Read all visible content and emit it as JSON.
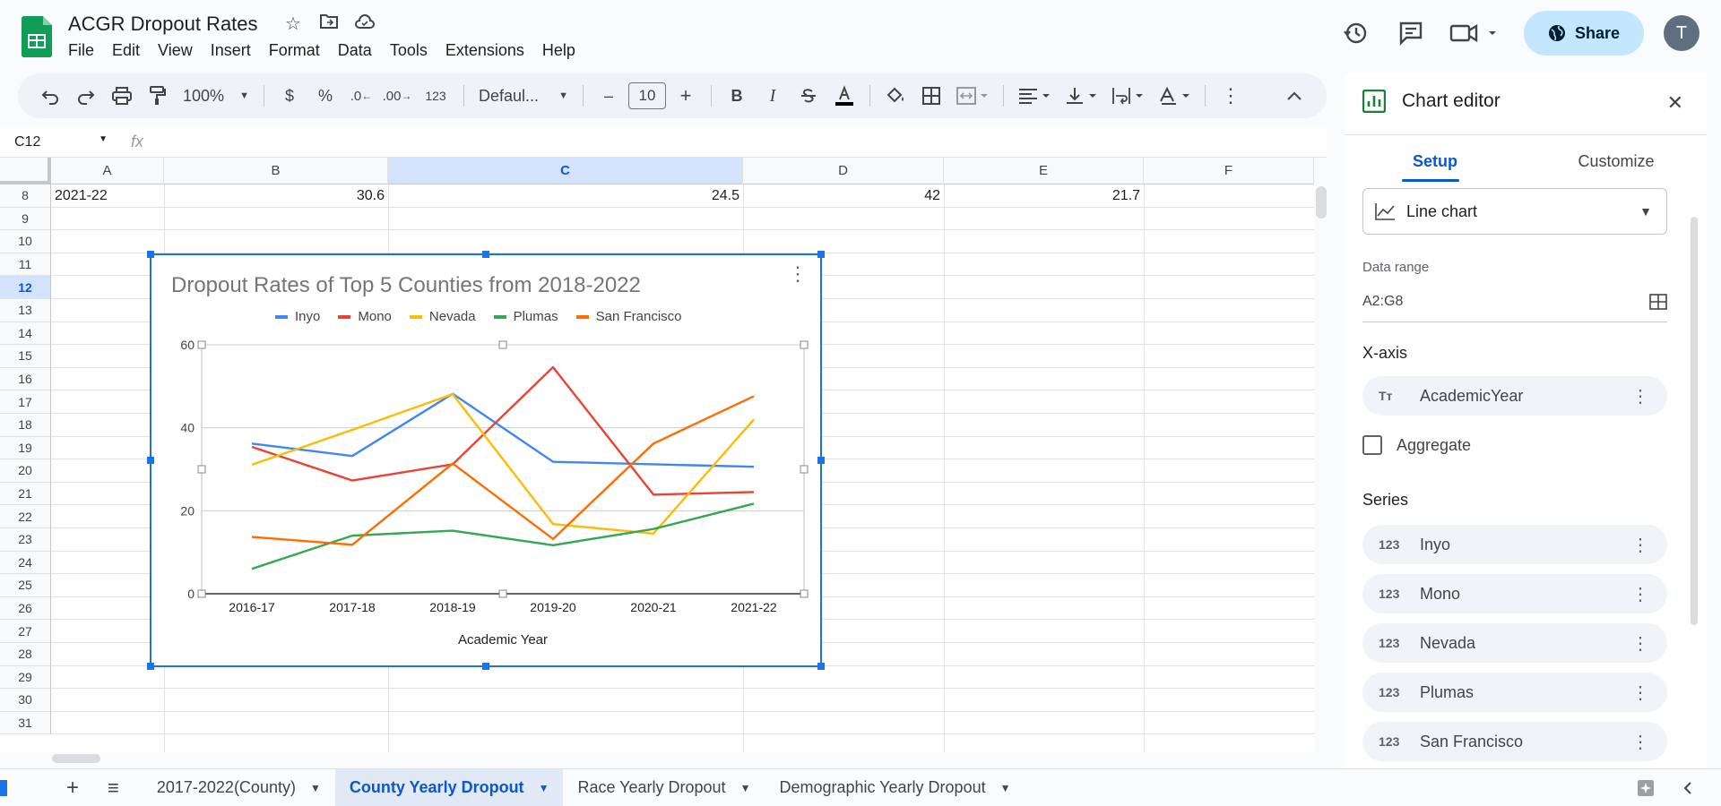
{
  "app": {
    "doc_title": "ACGR Dropout Rates",
    "menu": [
      "File",
      "Edit",
      "View",
      "Insert",
      "Format",
      "Data",
      "Tools",
      "Extensions",
      "Help"
    ],
    "share_label": "Share",
    "avatar_initial": "T"
  },
  "toolbar": {
    "zoom": "100%",
    "currency": "$",
    "percent": "%",
    "dec_decrease": ".0",
    "dec_increase": ".00",
    "number_format": "123",
    "font": "Defaul...",
    "font_size": "10",
    "minus": "–",
    "plus": "+",
    "bold": "B",
    "italic": "I"
  },
  "formula_bar": {
    "name_box": "C12",
    "fx": "fx"
  },
  "grid": {
    "columns": [
      "A",
      "B",
      "C",
      "D",
      "E",
      "F"
    ],
    "selected_column": "C",
    "rows": [
      "8",
      "9",
      "10",
      "11",
      "12",
      "13",
      "14",
      "15",
      "16",
      "17",
      "18",
      "19",
      "20",
      "21",
      "22",
      "23",
      "24",
      "25",
      "26",
      "27",
      "28",
      "29",
      "30",
      "31"
    ],
    "selected_row": "12",
    "row8": {
      "A": "2021-22",
      "B": "30.6",
      "C": "24.5",
      "D": "42",
      "E": "21.7"
    }
  },
  "chart_data": {
    "type": "line",
    "title": "Dropout Rates of Top 5 Counties from 2018-2022",
    "xlabel": "Academic Year",
    "ylabel": "",
    "x": [
      "2016-17",
      "2017-18",
      "2018-19",
      "2019-20",
      "2020-21",
      "2021-22"
    ],
    "ylim": [
      0,
      60
    ],
    "yticks": [
      "0",
      "20",
      "40",
      "60"
    ],
    "grid": true,
    "legend_position": "top",
    "series": [
      {
        "name": "Inyo",
        "color": "#4285f4",
        "values": [
          36.2,
          33.2,
          48.2,
          31.8,
          31.2,
          30.6
        ]
      },
      {
        "name": "Mono",
        "color": "#ea4335",
        "values": [
          35.4,
          27.3,
          31.2,
          54.6,
          23.9,
          24.5
        ]
      },
      {
        "name": "Nevada",
        "color": "#fbbc04",
        "values": [
          31.1,
          39.5,
          48.1,
          16.8,
          14.5,
          42.0
        ]
      },
      {
        "name": "Plumas",
        "color": "#34a853",
        "values": [
          6.0,
          14.0,
          15.2,
          11.7,
          15.6,
          21.7
        ]
      },
      {
        "name": "San Francisco",
        "color": "#ff6d01",
        "values": [
          13.7,
          11.8,
          31.4,
          13.2,
          36.2,
          47.6
        ]
      }
    ]
  },
  "editor": {
    "title": "Chart editor",
    "tabs": [
      "Setup",
      "Customize"
    ],
    "chart_type": "Line chart",
    "data_range_label": "Data range",
    "data_range": "A2:G8",
    "xaxis_label": "X-axis",
    "xaxis_value": "AcademicYear",
    "aggregate_label": "Aggregate",
    "series_label": "Series",
    "series": [
      "Inyo",
      "Mono",
      "Nevada",
      "Plumas",
      "San Francisco"
    ],
    "num_icon": "123",
    "text_icon": "Tᴛ"
  },
  "sheets": {
    "add": "+",
    "tabs": [
      "2017-2022(County)",
      "County Yearly Dropout",
      "Race Yearly Dropout",
      "Demographic Yearly Dropout"
    ],
    "active_index": 1
  }
}
